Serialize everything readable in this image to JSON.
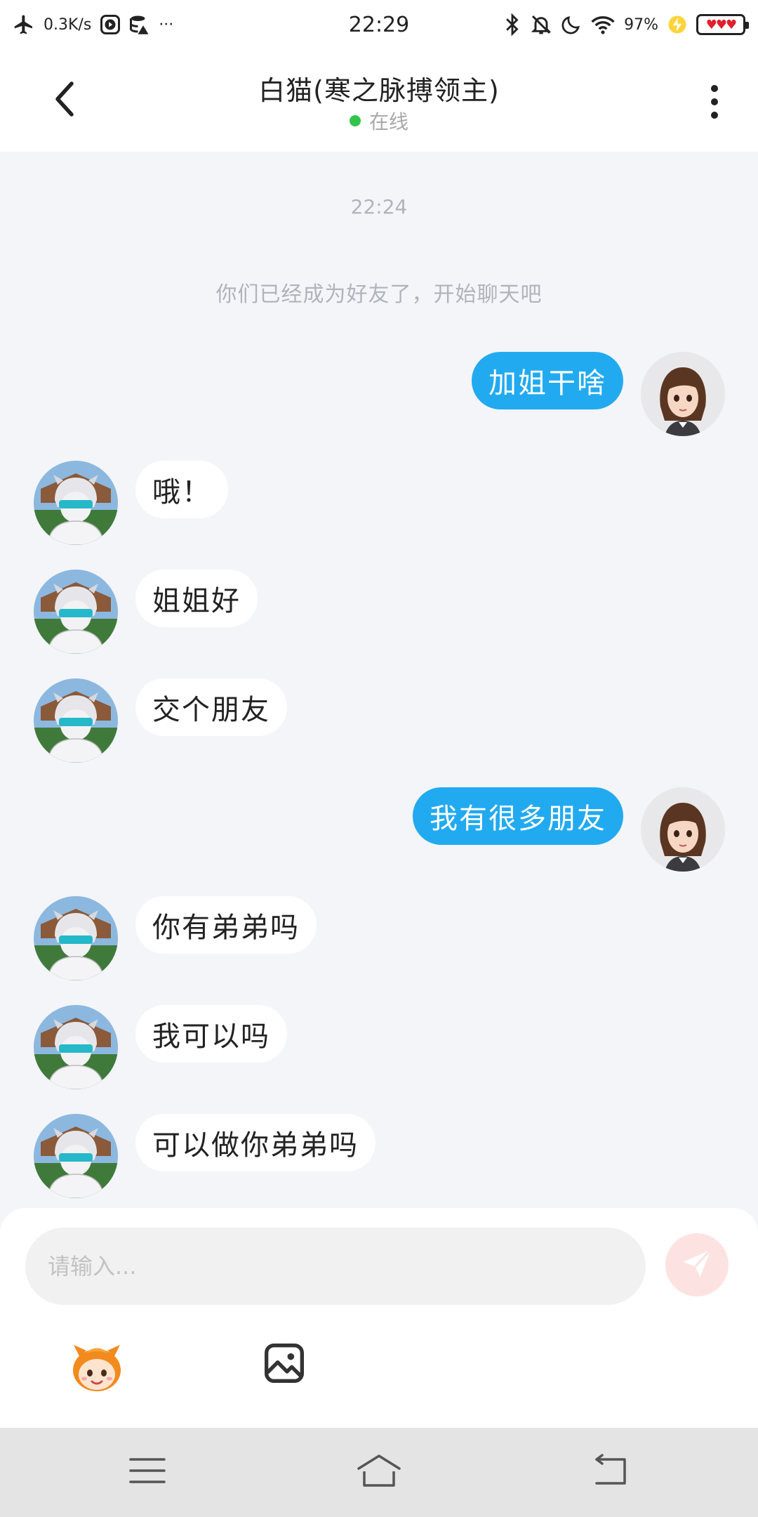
{
  "status_bar": {
    "speed": "0.3K/s",
    "time": "22:29",
    "battery_percent": "97%",
    "more": "···",
    "icons": [
      "airplane-icon",
      "play-icon",
      "data-icon",
      "bluetooth-icon",
      "mute-bell-icon",
      "moon-icon",
      "wifi-icon",
      "charging-icon",
      "battery-icon"
    ]
  },
  "header": {
    "title": "白猫(寒之脉搏领主)",
    "status": "在线",
    "status_color": "#33c34a"
  },
  "chat": {
    "timestamp": "22:24",
    "system_message": "你们已经成为好友了，开始聊天吧",
    "messages": [
      {
        "from": "me",
        "text": "加姐干啥"
      },
      {
        "from": "them",
        "text": "哦！"
      },
      {
        "from": "them",
        "text": "姐姐好"
      },
      {
        "from": "them",
        "text": "交个朋友"
      },
      {
        "from": "me",
        "text": "我有很多朋友"
      },
      {
        "from": "them",
        "text": "你有弟弟吗"
      },
      {
        "from": "them",
        "text": "我可以吗"
      },
      {
        "from": "them",
        "text": "可以做你弟弟吗"
      }
    ]
  },
  "composer": {
    "placeholder": "请输入...",
    "value": "",
    "send_icon": "send-icon",
    "emoji_icon": "sticker-icon",
    "image_icon": "image-icon"
  },
  "navbar": {
    "icons": [
      "menu-icon",
      "home-icon",
      "back-icon"
    ]
  },
  "colors": {
    "my_bubble": "#22aaf0",
    "their_bubble": "#ffffff",
    "background": "#f3f5f8"
  }
}
